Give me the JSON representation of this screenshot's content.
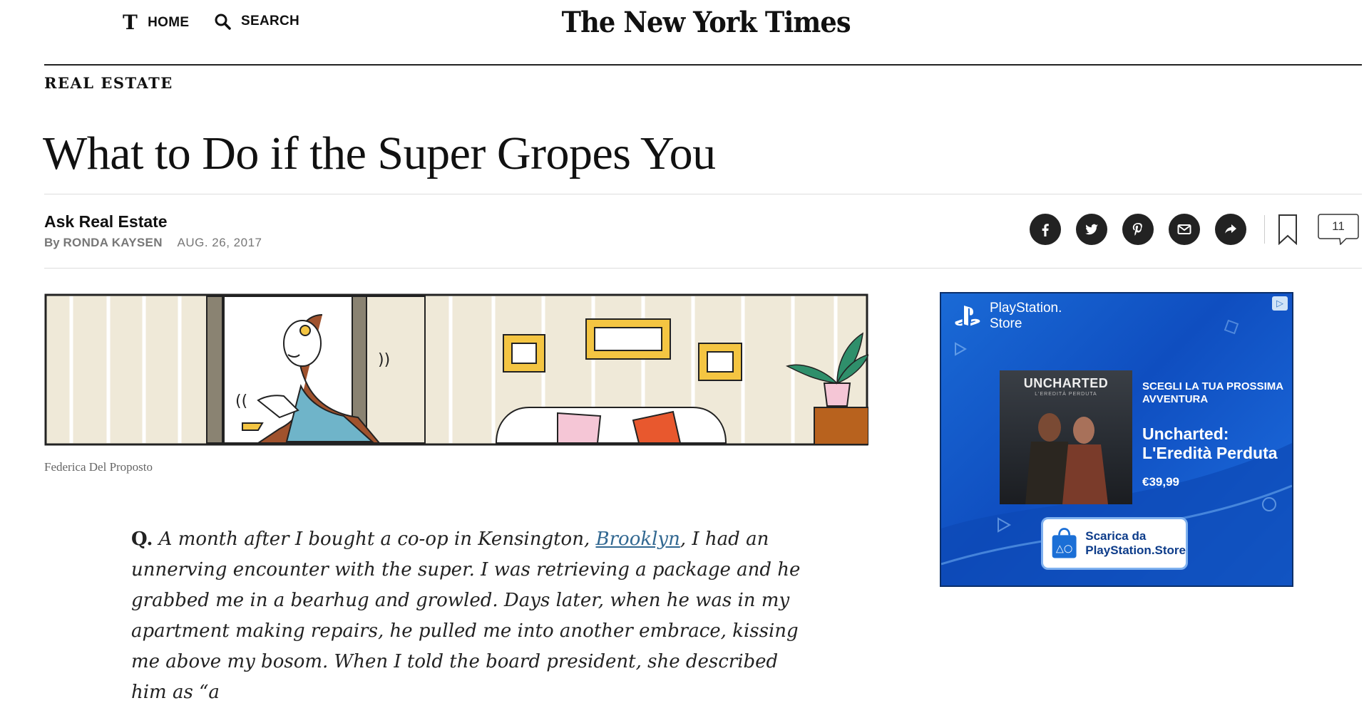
{
  "nav": {
    "home_label": "HOME",
    "search_label": "SEARCH",
    "logo_letter": "T",
    "masthead": "The New York Times"
  },
  "article": {
    "section": "REAL ESTATE",
    "headline": "What to Do if the Super Gropes You",
    "kicker": "Ask Real Estate",
    "byline_prefix": "By",
    "author": "RONDA KAYSEN",
    "date": "AUG. 26, 2017",
    "comment_count": "11",
    "image_credit": "Federica Del Proposto",
    "body": {
      "q_label": "Q.",
      "text_before_link": "A month after I bought a co-op in Kensington, ",
      "link_text": "Brooklyn",
      "text_after_link": ", I had an unnerving encounter with the super. I was retrieving a package and he grabbed me in a bearhug and growled. Days later, when he was in my apartment making repairs, he pulled me into another embrace, kissing me above my bosom. When I told the board president, she described him as “a"
    }
  },
  "share_icons": [
    "facebook-icon",
    "twitter-icon",
    "pinterest-icon",
    "email-icon",
    "share-icon"
  ],
  "ad": {
    "brand_line1": "PlayStation.",
    "brand_line2": "Store",
    "adchoice": "▷",
    "box_title": "UNCHARTED",
    "box_subtitle": "L'EREDITÀ PERDUTA",
    "tagline": "SCEGLI LA TUA PROSSIMA AVVENTURA",
    "game_title": "Uncharted: L'Eredità Perduta",
    "price": "€39,99",
    "cta_line1": "Scarica da",
    "cta_line2": "PlayStation.Store",
    "colors": {
      "background": "#1565d8",
      "border": "#0b2f6a"
    }
  },
  "colors": {
    "link": "#326891",
    "text": "#111111",
    "muted": "#777777"
  }
}
